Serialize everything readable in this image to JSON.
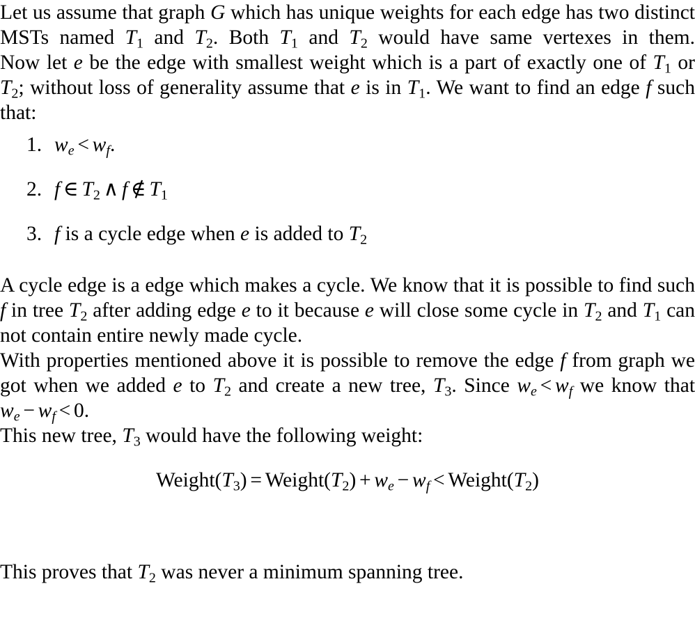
{
  "document": {
    "type": "mathematical-proof",
    "topic": "Minimum Spanning Tree uniqueness proof",
    "paragraphs": {
      "p1": "Let us assume that graph G which has unique weights for each edge has two distinct MSTs named T1 and T2. Both T1 and T2 would have same vertexes in them.",
      "p2": "Now let e be the edge with smallest weight which is a part of exactly one of T1 or T2; without loss of generality assume that e is in T1. We want to find an edge f such that:",
      "p3": "A cycle edge is a edge which makes a cycle. We know that it is possible to find such f in tree T2 after adding edge e to it because e will close some cycle in T2 and T1 can not contain entire newly made cycle.",
      "p4": "With properties mentioned above it is possible to remove the edge f from graph we got when we added e to T2 and create a new tree, T3. Since we < wf we know that we - wf < 0.",
      "p5": "This new tree, T3 would have the following weight:",
      "p6": "This proves that T2 was never a minimum spanning tree."
    },
    "p1_parts": {
      "seg1": "Let us assume that graph ",
      "var_G": "G",
      "seg2": " which has unique weights for each edge has two distinct MSTs named ",
      "var_T_a": "T",
      "sub_1a": "1",
      "seg3": " and ",
      "var_T_b": "T",
      "sub_2b": "2",
      "seg4": ". Both ",
      "var_T_c": "T",
      "sub_1c": "1",
      "seg5": " and ",
      "var_T_d": "T",
      "sub_2d": "2",
      "seg6": " would have same vertexes in them."
    },
    "p2_parts": {
      "seg1": "Now let ",
      "var_e1": "e",
      "seg2": " be the edge with smallest weight which is a part of exactly one of ",
      "var_T_a": "T",
      "sub_1a": "1",
      "seg3": " or ",
      "var_T_b": "T",
      "sub_2b": "2",
      "seg4": "; without loss of generality assume that ",
      "var_e2": "e",
      "seg5": " is in ",
      "var_T_c": "T",
      "sub_1c": "1",
      "seg6": ". We want to find an edge ",
      "var_f": "f",
      "seg7": " such that:"
    },
    "list": [
      {
        "marker": "1.",
        "parts": {
          "var_w1": "w",
          "sub_e": "e",
          "op_lt": "<",
          "var_w2": "w",
          "sub_f": "f",
          "period": "."
        },
        "plain": "we < wf."
      },
      {
        "marker": "2.",
        "parts": {
          "var_f1": "f",
          "op_in": "∈",
          "var_T1": "T",
          "sub_2": "2",
          "op_and": "∧",
          "var_f2": "f",
          "op_notin": "∉",
          "var_T2": "T",
          "sub_1": "1"
        },
        "plain": "f ∈ T2 ∧ f ∉ T1"
      },
      {
        "marker": "3.",
        "parts": {
          "var_f": "f",
          "seg1": " is a cycle edge when ",
          "var_e": "e",
          "seg2": " is added to ",
          "var_T": "T",
          "sub_2": "2"
        },
        "plain": "f is a cycle edge when e is added to T2"
      }
    ],
    "p3_parts": {
      "seg1": "A cycle edge is a edge which makes a cycle. We know that it is possible to find such ",
      "var_f": "f",
      "seg2": " in tree ",
      "var_T_a": "T",
      "sub_2a": "2",
      "seg3": " after adding edge ",
      "var_e1": "e",
      "seg4": " to it because ",
      "var_e2": "e",
      "seg5": " will close some cycle in ",
      "var_T_b": "T",
      "sub_2b": "2",
      "seg6": " and ",
      "var_T_c": "T",
      "sub_1c": "1",
      "seg7": " can not contain entire newly made cycle."
    },
    "p4_parts": {
      "seg1": "With properties mentioned above it is possible to remove the edge ",
      "var_f": "f",
      "seg2": " from graph we got when we added ",
      "var_e": "e",
      "seg3": " to ",
      "var_T_a": "T",
      "sub_2a": "2",
      "seg4": " and create a new tree, ",
      "var_T_b": "T",
      "sub_3b": "3",
      "seg5": ". Since ",
      "var_w1": "w",
      "sub_e1": "e",
      "op_lt1": "<",
      "var_w2": "w",
      "sub_f1": "f",
      "seg6": " we know that ",
      "var_w3": "w",
      "sub_e2": "e",
      "op_minus": "−",
      "var_w4": "w",
      "sub_f2": "f",
      "op_lt2": "<",
      "num_zero": "0",
      "period": "."
    },
    "p5_parts": {
      "seg1": "This new tree, ",
      "var_T": "T",
      "sub_3": "3",
      "seg2": " would have the following weight:"
    },
    "equation": {
      "latex": "Weight(T_3) = Weight(T_2) + w_e - w_f < Weight(T_2)",
      "plain": "Weight(T3) = Weight(T2) + we − wf < Weight(T2)",
      "parts": {
        "fn1": "Weight(",
        "var_T1": "T",
        "sub_3": "3",
        "close1": ")",
        "op_eq": "=",
        "fn2": "Weight(",
        "var_T2": "T",
        "sub_2a": "2",
        "close2": ")",
        "op_plus": "+",
        "var_w1": "w",
        "sub_e": "e",
        "op_minus": "−",
        "var_w2": "w",
        "sub_f": "f",
        "op_lt": "<",
        "fn3": "Weight(",
        "var_T3": "T",
        "sub_2b": "2",
        "close3": ")"
      }
    },
    "p6_parts": {
      "seg1": "This proves that ",
      "var_T": "T",
      "sub_2": "2",
      "seg2": " was never a minimum spanning tree."
    }
  },
  "colors": {
    "text": "#000000",
    "background": "#ffffff"
  }
}
